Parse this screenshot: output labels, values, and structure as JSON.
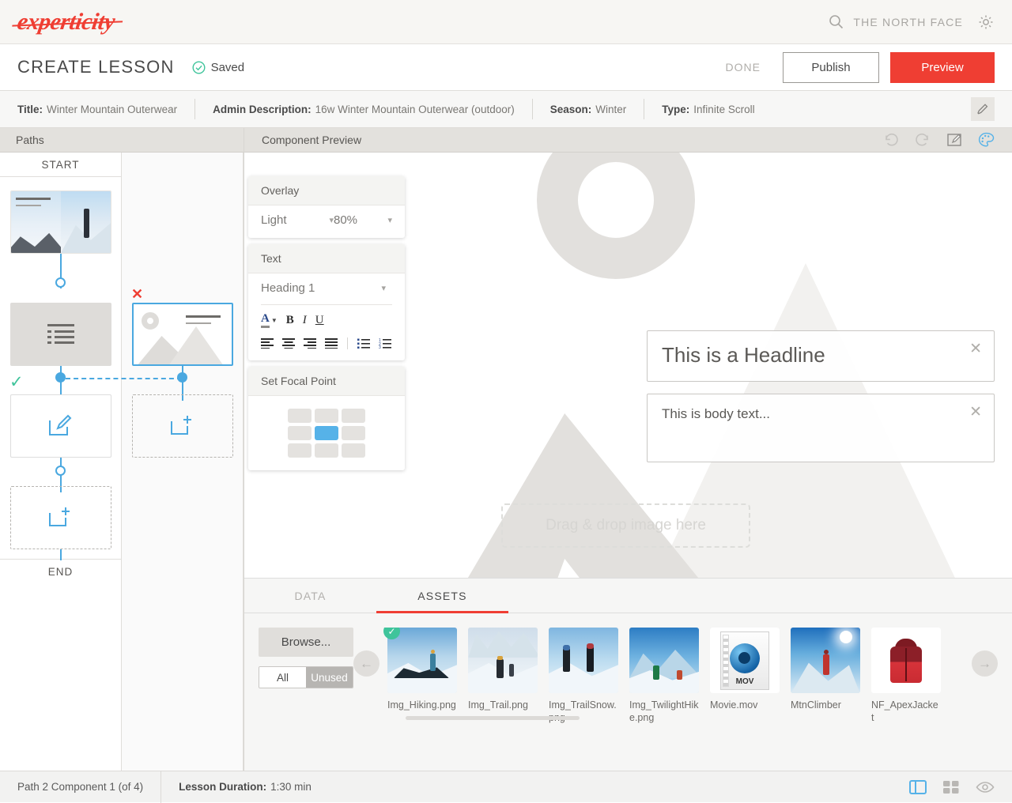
{
  "brand": {
    "logo_text": "experticity",
    "logo_color": "#ef3e33",
    "search_value": "THE NORTH FACE",
    "search_icon": "search-icon",
    "settings_icon": "gear-icon"
  },
  "action_bar": {
    "page_title": "CREATE LESSON",
    "saved_label": "Saved",
    "saved_color": "#3fc49b",
    "done_label": "DONE",
    "publish_label": "Publish",
    "preview_label": "Preview",
    "preview_color": "#ef3e33"
  },
  "meta": {
    "fields": [
      {
        "label": "Title:",
        "value": "Winter Mountain Outerwear"
      },
      {
        "label": "Admin Description:",
        "value": "16w Winter Mountain Outerwear (outdoor)"
      },
      {
        "label": "Season:",
        "value": "Winter"
      },
      {
        "label": "Type:",
        "value": "Infinite Scroll"
      }
    ],
    "edit_icon": "pencil-icon"
  },
  "paths": {
    "panel_title": "Paths",
    "start_label": "START",
    "end_label": "END",
    "path1_nodes": [
      {
        "kind": "hero-thumbnail",
        "headline": "This is a Headline",
        "body": "This is body text..."
      },
      {
        "kind": "list-component"
      },
      {
        "kind": "edit-component"
      },
      {
        "kind": "add-component"
      }
    ],
    "path2_nodes": [
      {
        "kind": "image-component-selected",
        "headline": "This is a Headline",
        "body": "This is body text..."
      },
      {
        "kind": "add-component"
      }
    ],
    "delete_icon": "close-x-icon",
    "valid_icon": "check-icon",
    "accent_color": "#4aa8e0"
  },
  "preview": {
    "panel_title": "Component Preview",
    "tools": [
      {
        "name": "undo-icon",
        "enabled": false
      },
      {
        "name": "redo-icon",
        "enabled": false
      },
      {
        "name": "edit-icon",
        "enabled": true
      },
      {
        "name": "theme-palette-icon",
        "enabled": true
      }
    ],
    "headline_value": "This is a Headline",
    "body_value": "This is body text...",
    "dropzone_label": "Drag & drop image here",
    "close_icon": "close-icon"
  },
  "inspector": {
    "overlay": {
      "title": "Overlay",
      "style_value": "Light",
      "opacity_value": "80%",
      "chevron_icon": "chevron-down-icon"
    },
    "text": {
      "title": "Text",
      "style_value": "Heading 1",
      "chevron_icon": "chevron-down-icon",
      "buttons": [
        {
          "name": "font-color-icon",
          "label": "A"
        },
        {
          "name": "bold-icon",
          "label": "B"
        },
        {
          "name": "italic-icon",
          "label": "I"
        },
        {
          "name": "underline-icon",
          "label": "U"
        }
      ],
      "align_buttons": [
        "align-left-icon",
        "align-center-icon",
        "align-right-icon",
        "align-justify-icon",
        "bulleted-list-icon",
        "numbered-list-icon"
      ]
    },
    "focal": {
      "title": "Set Focal Point",
      "active_cell": 4,
      "active_color": "#56b2e8"
    }
  },
  "drawer": {
    "tabs": [
      {
        "label": "DATA",
        "active": false
      },
      {
        "label": "ASSETS",
        "active": true
      }
    ],
    "active_tab_color": "#ef3e33",
    "browse_label": "Browse...",
    "filter": {
      "all_label": "All",
      "unused_label": "Unused",
      "selected": "All"
    },
    "prev_icon": "arrow-left-icon",
    "next_icon": "arrow-right-icon",
    "assets": [
      {
        "name": "Img_Hiking.png",
        "type": "image",
        "selected": true
      },
      {
        "name": "Img_Trail.png",
        "type": "image",
        "selected": false
      },
      {
        "name": "Img_TrailSnow.png",
        "type": "image",
        "selected": false
      },
      {
        "name": "Img_TwilightHike.png",
        "type": "image",
        "selected": false
      },
      {
        "name": "Movie.mov",
        "type": "video",
        "selected": false
      },
      {
        "name": "MtnClimber",
        "type": "image",
        "selected": false
      },
      {
        "name": "NF_ApexJacket",
        "type": "image",
        "selected": false
      }
    ]
  },
  "status": {
    "component_position": "Path 2 Component 1 (of 4)",
    "duration_label": "Lesson Duration:",
    "duration_value": "1:30 min",
    "view_icons": [
      {
        "name": "split-view-icon",
        "active": true
      },
      {
        "name": "grid-view-icon",
        "active": false
      },
      {
        "name": "eye-preview-icon",
        "active": false
      }
    ]
  }
}
